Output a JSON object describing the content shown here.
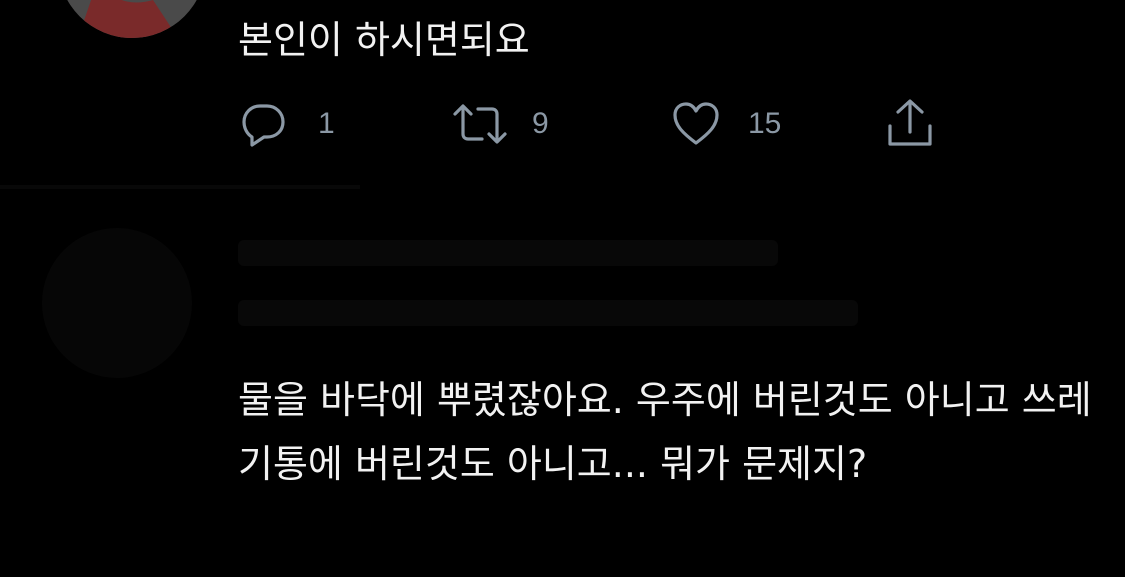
{
  "tweet_1": {
    "text": "본인이 하시면되요",
    "actions": {
      "reply": {
        "icon": "reply-icon",
        "count": "1"
      },
      "retweet": {
        "icon": "retweet-icon",
        "count": "9"
      },
      "like": {
        "icon": "heart-icon",
        "count": "15"
      },
      "share": {
        "icon": "share-icon"
      }
    }
  },
  "tweet_2": {
    "text": "물을 바닥에 뿌렸잖아요. 우주에 버린것도 아니고 쓰레기통에 버린것도 아니고... 뭐가 문제지?"
  },
  "colors": {
    "background": "#000000",
    "text": "#f2f2f2",
    "secondary": "#8b98a5"
  }
}
